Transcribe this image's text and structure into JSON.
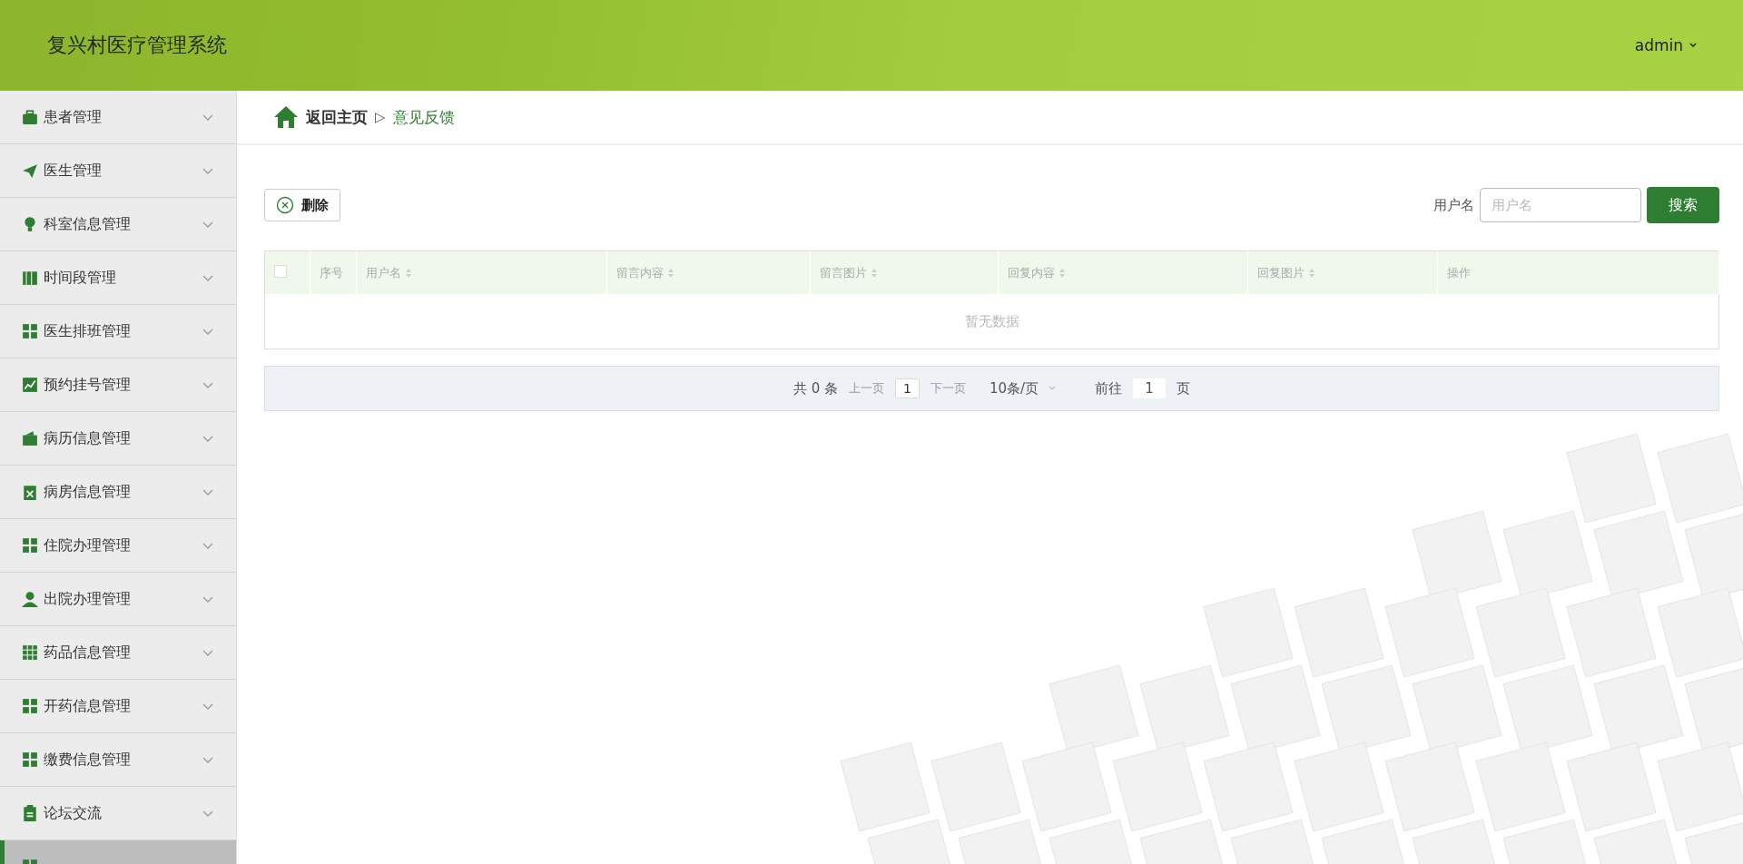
{
  "header": {
    "title": "复兴村医疗管理系统",
    "user": "admin"
  },
  "sidebar": {
    "items": [
      {
        "label": "患者管理",
        "selected": false
      },
      {
        "label": "医生管理",
        "selected": false
      },
      {
        "label": "科室信息管理",
        "selected": false
      },
      {
        "label": "时间段管理",
        "selected": false
      },
      {
        "label": "医生排班管理",
        "selected": false
      },
      {
        "label": "预约挂号管理",
        "selected": false
      },
      {
        "label": "病历信息管理",
        "selected": false
      },
      {
        "label": "病房信息管理",
        "selected": false
      },
      {
        "label": "住院办理管理",
        "selected": false
      },
      {
        "label": "出院办理管理",
        "selected": false
      },
      {
        "label": "药品信息管理",
        "selected": false
      },
      {
        "label": "开药信息管理",
        "selected": false
      },
      {
        "label": "缴费信息管理",
        "selected": false
      },
      {
        "label": "论坛交流",
        "selected": false
      },
      {
        "selected": true
      }
    ]
  },
  "breadcrumb": {
    "home": "返回主页",
    "separator": "▷",
    "current": "意见反馈"
  },
  "toolbar": {
    "delete_button": "删除",
    "search_label": "用户名",
    "search": {
      "placeholder": "用户名"
    },
    "search_button": "搜索"
  },
  "table": {
    "select_all": {
      "checked": false
    },
    "columns": [
      {
        "label": "序号",
        "sortable": false
      },
      {
        "label": "用户名",
        "sortable": true
      },
      {
        "label": "留言内容",
        "sortable": true
      },
      {
        "label": "留言图片",
        "sortable": true
      },
      {
        "label": "回复内容",
        "sortable": true
      },
      {
        "label": "回复图片",
        "sortable": true
      },
      {
        "label": "操作",
        "sortable": false
      }
    ],
    "empty_text": "暂无数据"
  },
  "pagination": {
    "total": "共 0 条",
    "prev": "上一页",
    "page": "1",
    "next": "下一页",
    "page_size": "10条/页",
    "goto_label": "前往",
    "goto_value": "1",
    "goto_suffix": "页"
  }
}
